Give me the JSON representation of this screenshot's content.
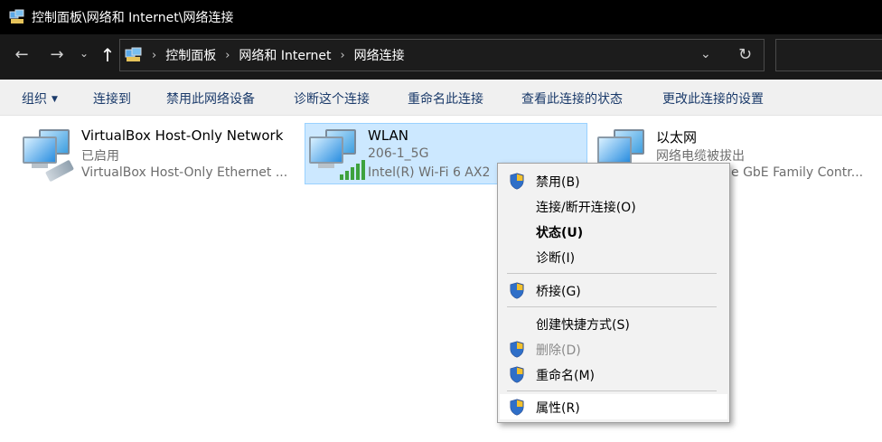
{
  "window": {
    "title": "控制面板\\网络和 Internet\\网络连接"
  },
  "address": {
    "breadcrumbs": [
      "控制面板",
      "网络和 Internet",
      "网络连接"
    ]
  },
  "toolbar": {
    "organize": "组织",
    "commands": [
      "连接到",
      "禁用此网络设备",
      "诊断这个连接",
      "重命名此连接",
      "查看此连接的状态",
      "更改此连接的设置"
    ]
  },
  "connections": [
    {
      "name": "VirtualBox Host-Only Network",
      "status": "已启用",
      "device": "VirtualBox Host-Only Ethernet ...",
      "icon": "ethernet-adapter-icon"
    },
    {
      "name": "WLAN",
      "status": "206-1_5G",
      "device": "Intel(R) Wi-Fi 6 AX2",
      "icon": "wifi-adapter-icon",
      "selected": true
    },
    {
      "name": "以太网",
      "status": "网络电缆被拔出",
      "device": "e GbE Family Contr...",
      "icon": "ethernet-adapter-icon"
    }
  ],
  "context_menu": {
    "items": [
      {
        "label": "禁用(B)",
        "icon": "uac-shield-icon"
      },
      {
        "label": "连接/断开连接(O)"
      },
      {
        "label": "状态(U)",
        "bold": true
      },
      {
        "label": "诊断(I)"
      },
      {
        "label": "桥接(G)",
        "icon": "uac-shield-icon"
      },
      {
        "label": "创建快捷方式(S)"
      },
      {
        "label": "删除(D)",
        "icon": "uac-shield-icon",
        "disabled": true
      },
      {
        "label": "重命名(M)",
        "icon": "uac-shield-icon"
      },
      {
        "label": "属性(R)",
        "icon": "uac-shield-icon",
        "highlighted": true
      }
    ]
  },
  "colors": {
    "titlebar": "#000000",
    "addressbar": "#191919",
    "selection": "#cce8ff",
    "command_text": "#1a3a6a",
    "signal": "#3da23d"
  }
}
